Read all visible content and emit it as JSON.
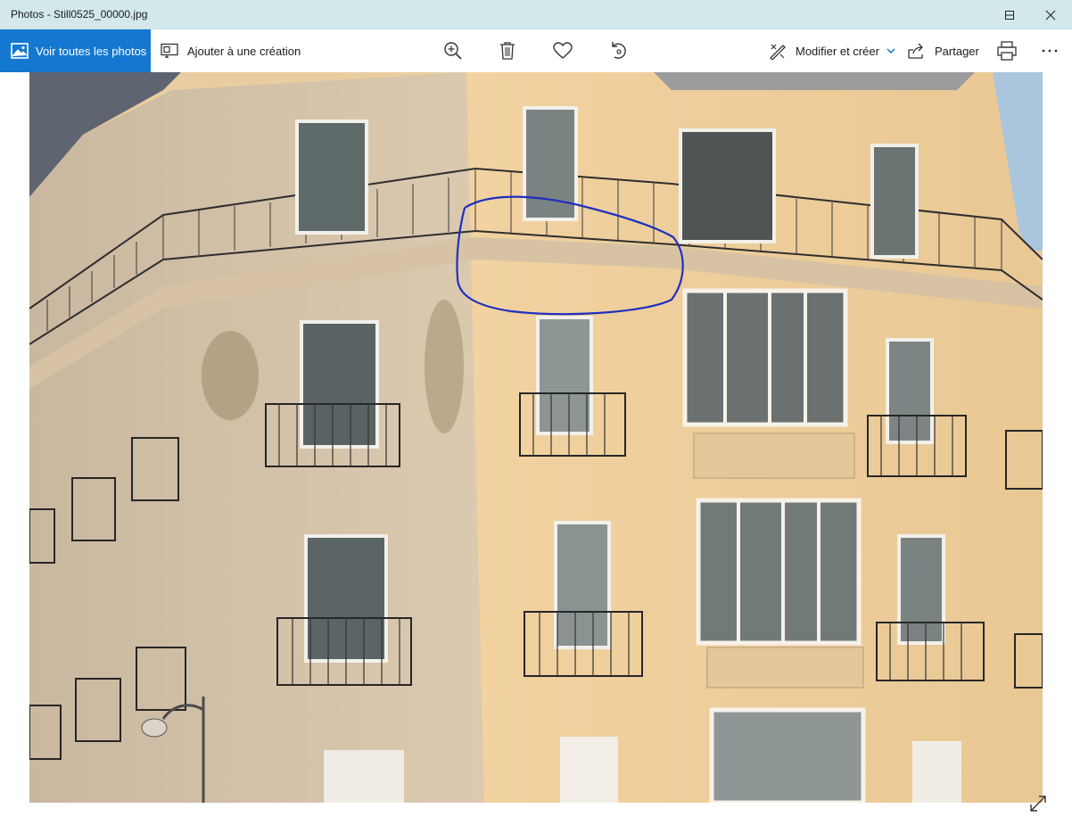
{
  "window": {
    "title": "Photos - Still0525_00000.jpg",
    "controls": [
      "minimize",
      "maximize",
      "close"
    ]
  },
  "toolbar": {
    "see_all_label": "Voir toutes les photos",
    "add_to_creation_label": "Ajouter à une création",
    "center_icons": [
      "zoom-in-icon",
      "delete-icon",
      "favorite-heart-icon",
      "rotate-icon"
    ],
    "edit_create_label": "Modifier et créer",
    "share_label": "Partager",
    "print_icon": "printer-icon",
    "more_icon": "more-icon",
    "accent_color": "#1578d0"
  },
  "photo": {
    "description_icon": "building-photo",
    "annotation_color": "#1f2fbf"
  },
  "footer": {
    "expand_icon": "expand-icon"
  }
}
